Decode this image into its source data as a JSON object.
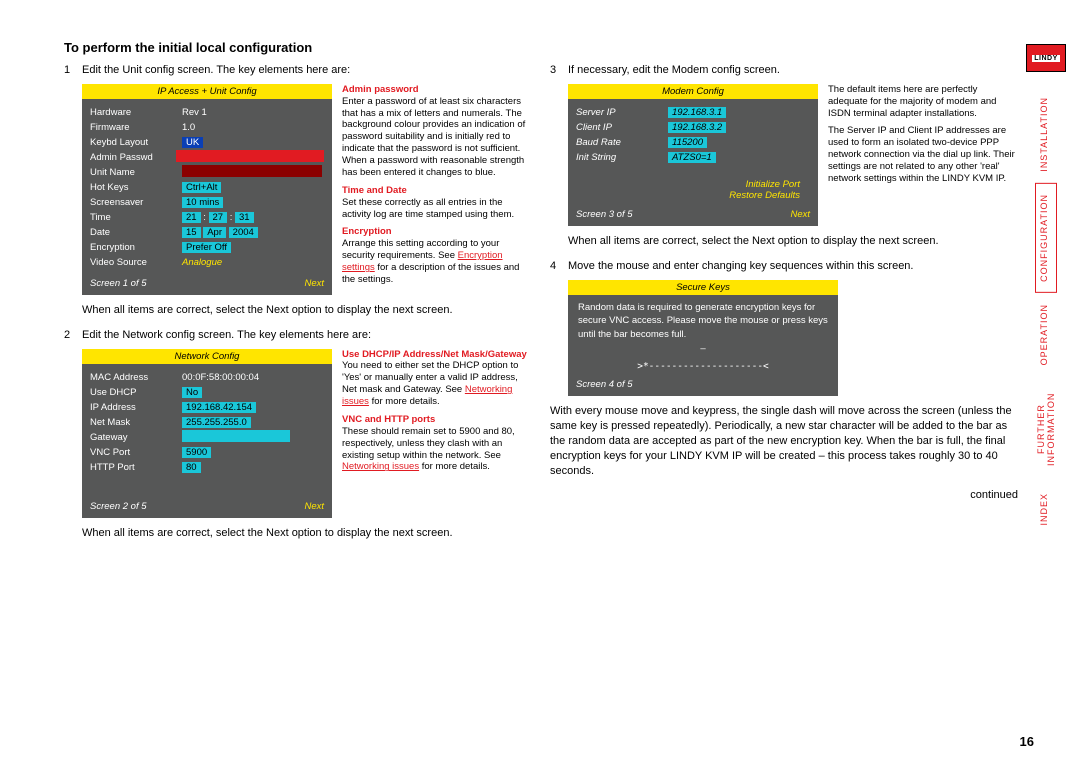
{
  "heading": "To perform the initial local configuration",
  "steps": {
    "s1": "Edit the Unit config screen. The key elements here are:",
    "s1_after": "When all items are correct, select the Next option to display the next screen.",
    "s2": "Edit the Network config screen. The key elements here are:",
    "s2_after": "When all items are correct, select the Next option to display the next screen.",
    "s3": "If necessary, edit the Modem config screen.",
    "s3_after": "When all items are correct, select the Next option to display the next screen.",
    "s4": "Move the mouse and enter changing key sequences within this screen.",
    "s4_after": "With every mouse move and keypress, the single dash will move across the screen (unless the same key is pressed repeatedly). Periodically, a new star character will be added to the bar as the random data are accepted as part of the new encryption key. When the bar is full, the final encryption keys for your LINDY KVM IP will be created – this process takes roughly 30 to 40 seconds."
  },
  "continued": "continued",
  "pagenum": "16",
  "unit": {
    "title": "IP Access + Unit Config",
    "hardware_l": "Hardware",
    "hardware_v": "Rev 1",
    "firmware_l": "Firmware",
    "firmware_v": "1.0",
    "keybd_l": "Keybd Layout",
    "keybd_v": "UK",
    "admin_l": "Admin Passwd",
    "unit_l": "Unit Name",
    "hot_l": "Hot Keys",
    "hot_v": "Ctrl+Alt",
    "scr_l": "Screensaver",
    "scr_v": "10 mins",
    "time_l": "Time",
    "time_h": "21",
    "time_m": "27",
    "time_s": "31",
    "date_l": "Date",
    "date_d": "15",
    "date_mo": "Apr",
    "date_y": "2004",
    "enc_l": "Encryption",
    "enc_v": "Prefer Off",
    "vid_l": "Video Source",
    "vid_v": "Analogue",
    "footer_l": "Screen 1 of 5",
    "footer_r": "Next"
  },
  "unit_side": {
    "h1": "Admin password",
    "p1": "Enter a password of at least six characters that has a mix of letters and numerals. The background colour provides an indication of password suitability and is initially red to indicate that the password is not sufficient. When a password with reasonable strength has been entered it changes to blue.",
    "h2": "Time and Date",
    "p2": "Set these correctly as all entries in the activity log are time stamped using them.",
    "h3": "Encryption",
    "p3a": "Arrange this setting according to your security requirements. See",
    "p3link": "Encryption settings",
    "p3b": " for a description of the issues and the settings."
  },
  "net": {
    "title": "Network Config",
    "mac_l": "MAC Address",
    "mac_v": "00:0F:58:00:00:04",
    "dhcp_l": "Use DHCP",
    "dhcp_v": "No",
    "ip_l": "IP Address",
    "ip_v": "192.168.42.154",
    "mask_l": "Net Mask",
    "mask_v": "255.255.255.0",
    "gw_l": "Gateway",
    "vnc_l": "VNC Port",
    "vnc_v": "5900",
    "http_l": "HTTP Port",
    "http_v": "80",
    "footer_l": "Screen 2 of 5",
    "footer_r": "Next"
  },
  "net_side": {
    "h1": "Use DHCP/IP Address/Net Mask/Gateway",
    "p1a": "You need to either set the DHCP option to 'Yes' or manually enter a valid IP address, Net mask and Gateway. See ",
    "p1link": "Networking issues",
    "p1b": " for more details.",
    "h2": "VNC and HTTP ports",
    "p2a": "These should remain set to 5900 and 80, respectively, unless they clash with an existing setup within the network. See ",
    "p2link": "Networking issues",
    "p2b": " for more details."
  },
  "modem": {
    "title": "Modem Config",
    "srv_l": "Server IP",
    "srv_v": "192.168.3.1",
    "cli_l": "Client IP",
    "cli_v": "192.168.3.2",
    "baud_l": "Baud Rate",
    "baud_v": "115200",
    "init_l": "Init String",
    "init_v": "ATZS0=1",
    "opt1": "Initialize Port",
    "opt2": "Restore Defaults",
    "footer_l": "Screen 3 of 5",
    "footer_r": "Next"
  },
  "modem_side": {
    "p1": "The default items here are perfectly adequate for the majority of modem and ISDN terminal adapter installations.",
    "p2": "The Server IP and Client IP addresses are used to form an isolated two-device PPP network connection via the dial up link. Their settings are not related to any other 'real' network settings within the LINDY KVM IP."
  },
  "secure": {
    "title": "Secure Keys",
    "body": "Random data is required to generate encryption keys for secure VNC access. Please move the mouse or press keys until the bar becomes full.",
    "dash": "–",
    "bar": ">*--------------------<",
    "footer_l": "Screen 4 of 5"
  },
  "tabs": {
    "brand": "LINDY",
    "t1": "INSTALLATION",
    "t2": "CONFIGURATION",
    "t3": "OPERATION",
    "t4": "FURTHER INFORMATION",
    "t5": "INDEX"
  }
}
